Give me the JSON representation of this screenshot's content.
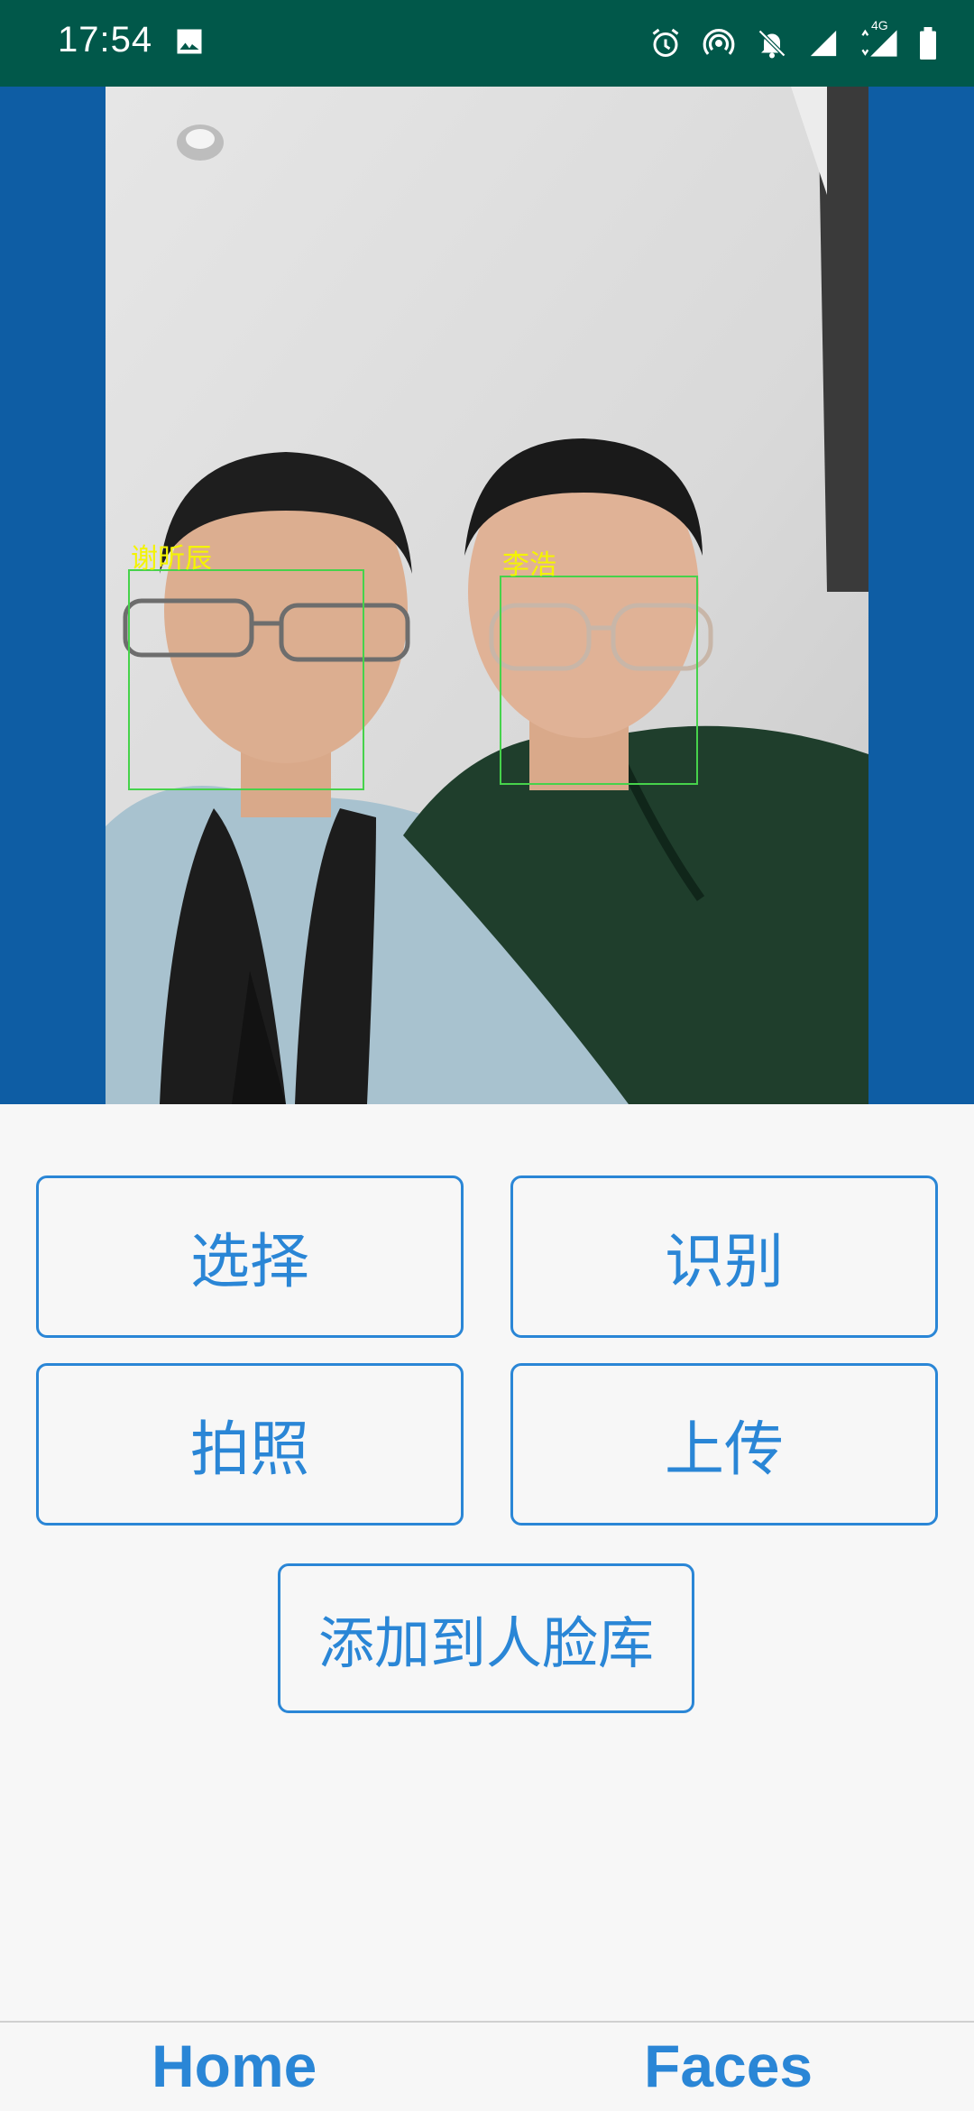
{
  "status_bar": {
    "time": "17:54",
    "left_icons": [
      "image-notification-icon"
    ],
    "right_icons": [
      "alarm-icon",
      "hotspot-icon",
      "mute-notification-icon",
      "signal-icon",
      "signal-4g-icon",
      "battery-icon"
    ],
    "network_label": "4G"
  },
  "photo": {
    "faces": [
      {
        "name": "谢昕辰"
      },
      {
        "name": "李浩"
      }
    ]
  },
  "buttons": {
    "select": "选择",
    "recognize": "识别",
    "take_photo": "拍照",
    "upload": "上传",
    "add_to_face_db": "添加到人脸库"
  },
  "bottom_nav": {
    "home": "Home",
    "faces": "Faces"
  },
  "colors": {
    "status_bar": "#01584a",
    "photo_background": "#0e5da4",
    "accent": "#2a86d6",
    "face_box": "#46d24b",
    "face_label": "#f4f400"
  }
}
